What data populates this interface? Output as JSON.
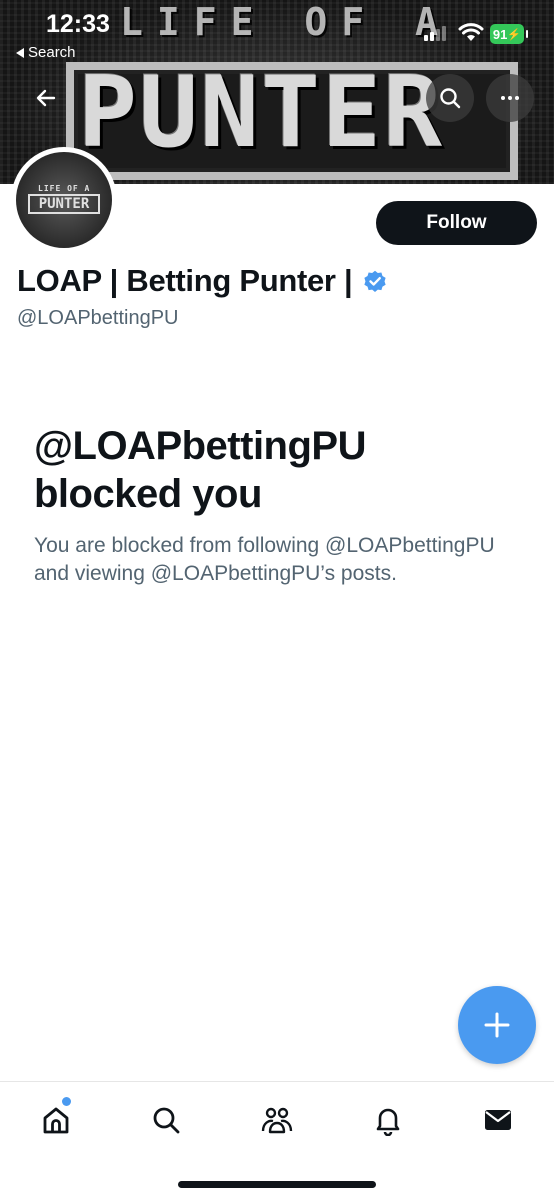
{
  "status_bar": {
    "time": "12:33",
    "back_label": "Search",
    "battery": "91"
  },
  "banner": {
    "top_text": "LIFE OF A",
    "main_text": "PUNTER"
  },
  "avatar": {
    "line1": "LIFE OF A",
    "line2": "PUNTER"
  },
  "header_actions": {
    "back_icon": "arrow-left-icon",
    "search_icon": "search-icon",
    "more_icon": "more-horizontal-icon"
  },
  "profile": {
    "display_name": "LOAP | Betting Punter |",
    "handle": "@LOAPbettingPU",
    "verified": true,
    "follow_label": "Follow"
  },
  "blocked": {
    "title": "@LOAPbettingPU blocked you",
    "description": "You are blocked from following @LOAPbettingPU and viewing @LOAPbettingPU’s posts."
  },
  "tabbar": {
    "items": [
      "home-icon",
      "search-icon",
      "communities-icon",
      "notifications-icon",
      "messages-icon"
    ],
    "accent": "#4a9af0"
  },
  "colors": {
    "accent": "#4a9af0",
    "text": "#0f1419",
    "secondary": "#536471",
    "battery": "#34c759"
  }
}
